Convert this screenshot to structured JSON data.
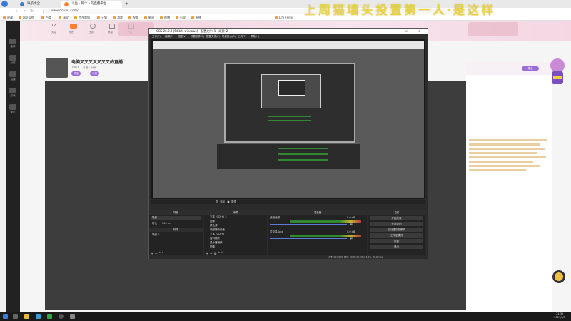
{
  "browser": {
    "tabs": [
      {
        "label": "导航大全",
        "active": false
      },
      {
        "label": "斗鱼 - 每个人的直播平台",
        "active": true
      }
    ],
    "url": "www.douyu.com/...",
    "bookmarks": [
      "收藏",
      "网址导航",
      "百度",
      "淘宝",
      "京东商城",
      "天猫",
      "游戏",
      "视频",
      "新闻",
      "微博",
      "小说",
      "直播",
      "Life Fenix"
    ],
    "colors": {
      "accent": "#3a7bd5",
      "brand": "#ff7f32"
    }
  },
  "page": {
    "float_title": "上周猫墙头投置第一人·是这样",
    "room_title": "电脑叉叉叉叉叉叉叉的直播",
    "sub_info": "100人  |  斗鱼 ·  分享",
    "left_nav": [
      "推荐",
      "分类",
      "直播",
      "游戏",
      "娱乐"
    ],
    "header_stats": [
      "12",
      "关注",
      "历史",
      "任务",
      "消息",
      "下载"
    ],
    "pills": [
      "关注",
      "订阅"
    ],
    "chat_action": "发送"
  },
  "obs": {
    "title": "OBS 26.0.0 (64 bit, windows) - 配置文件: 1 - 场景: 2",
    "menu": [
      "文件(F)",
      "编辑(E)",
      "视图(V)",
      "停靠部件(D)",
      "配置文件(P)",
      "场景集合(S)",
      "工具(T)",
      "帮助(H)"
    ],
    "toolbar": [
      "添加",
      "属性"
    ],
    "docks": {
      "scenes_label": "场景",
      "sources_label": "来源",
      "mixer_label": "混音器",
      "controls_label": "控件",
      "transition_label": "转场"
    },
    "scenes": [
      "场景",
      "场景 2"
    ],
    "sources": [
      "文本 (GDI+) 2",
      "图像",
      "颜色源",
      "视频捕获设备",
      "文本 (GDI+)",
      "窗口捕获",
      "显示器捕获",
      "图像"
    ],
    "mixer": [
      {
        "name": "桌面音频",
        "value": "0.0 dB"
      },
      {
        "name": "麦克风/Aux",
        "value": "0.0 dB"
      }
    ],
    "controls": [
      "开始推流",
      "开始录制",
      "启动虚拟摄像机",
      "工作室模式",
      "设置",
      "退出"
    ],
    "statusbar": "LIVE: 00:00:00   REC: 00:00:00   CPU: 4.4%, 30.00 fps",
    "transition": {
      "type": "淡出",
      "duration_label": "时长",
      "duration": "300 ms"
    }
  },
  "taskbar": {
    "time": "21:35",
    "date": "2021/3/1"
  }
}
